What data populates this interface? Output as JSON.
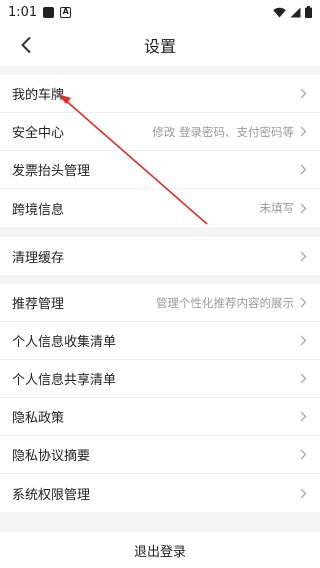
{
  "status_bar": {
    "time": "1:01"
  },
  "header": {
    "title": "设置"
  },
  "section1": [
    {
      "label": "我的车牌",
      "value": ""
    },
    {
      "label": "安全中心",
      "value": "修改 登录密码、支付密码等"
    },
    {
      "label": "发票抬头管理",
      "value": ""
    },
    {
      "label": "跨境信息",
      "value": "未填写"
    }
  ],
  "section2": [
    {
      "label": "清理缓存",
      "value": ""
    }
  ],
  "section3": [
    {
      "label": "推荐管理",
      "value": "管理个性化推荐内容的展示"
    },
    {
      "label": "个人信息收集清单",
      "value": ""
    },
    {
      "label": "个人信息共享清单",
      "value": ""
    },
    {
      "label": "隐私政策",
      "value": ""
    },
    {
      "label": "隐私协议摘要",
      "value": ""
    },
    {
      "label": "系统权限管理",
      "value": ""
    }
  ],
  "logout_label": "退出登录",
  "colors": {
    "annotation_arrow": "#d9302c",
    "background": "#f5f5f5"
  }
}
